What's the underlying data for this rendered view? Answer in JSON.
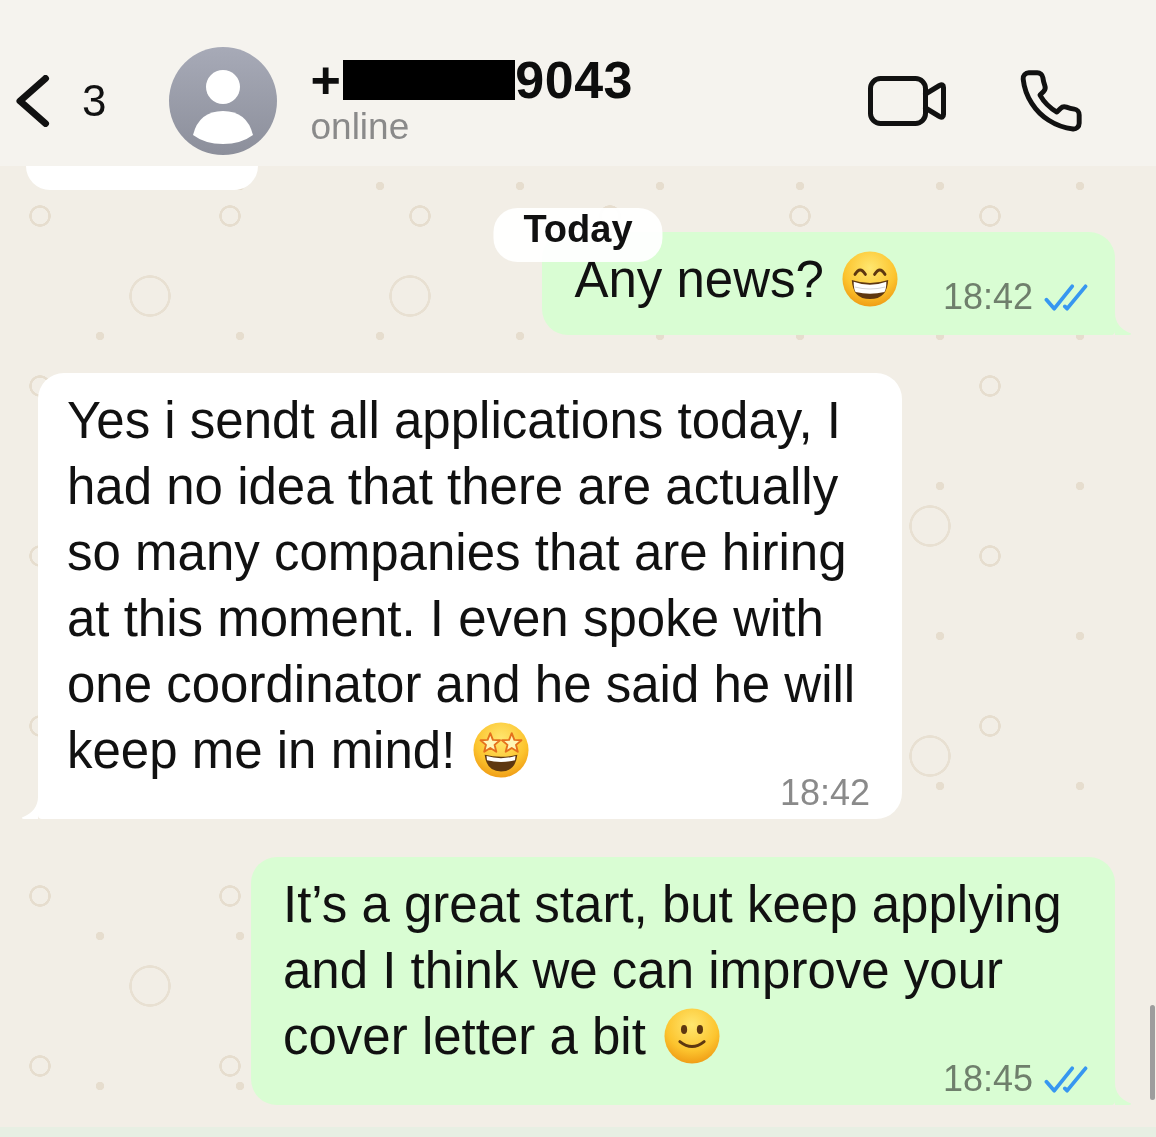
{
  "header": {
    "back_label": "3",
    "number_prefix": "+",
    "redacted": true,
    "number_suffix": "9043",
    "status": "online"
  },
  "date_label": "Today",
  "messages": [
    {
      "kind": "outgoing",
      "text": "Any news?",
      "emoji": {
        "kind": "grin"
      },
      "time": "18:42",
      "read": true
    },
    {
      "kind": "incoming",
      "text": "Yes i sendt all applications today, I had no idea that there are actually so many companies that are hiring at this moment. I even spoke with one coordinator and he said he will keep me in mind!",
      "emoji": {
        "kind": "starstruck"
      },
      "time": "18:42"
    },
    {
      "kind": "outgoing",
      "text": "It’s a great start, but keep applying and I think we can improve your cover letter a bit",
      "emoji": {
        "kind": "smile"
      },
      "time": "18:45",
      "read": true
    }
  ]
}
